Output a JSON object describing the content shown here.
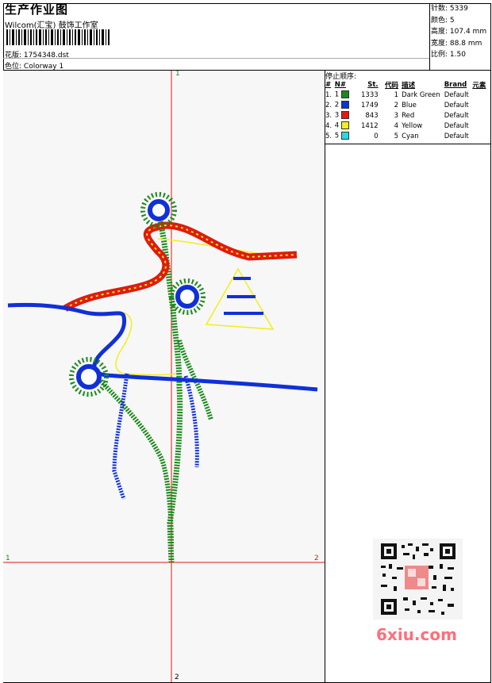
{
  "header": {
    "title": "生产作业图",
    "subtitle": "Wilcom(汇宝) 鼓饰工作室",
    "design_label": "花版:",
    "design_value": "1754348.dst",
    "colorway_label": "色位:",
    "colorway_value": "Colorway 1"
  },
  "stats": [
    {
      "label": "针数:",
      "value": "5339"
    },
    {
      "label": "颜色:",
      "value": "5"
    },
    {
      "label": "高度:",
      "value": "107.4 mm"
    },
    {
      "label": "宽度:",
      "value": "88.8 mm"
    },
    {
      "label": "比例:",
      "value": "1.50"
    }
  ],
  "stop_sequence": {
    "title": "停止顺序:",
    "headers": [
      "#",
      "N#",
      "St.",
      "代码",
      "描述",
      "Brand",
      "元素"
    ],
    "rows": [
      {
        "idx": "1.",
        "n": "1",
        "color": "#1a8a1a",
        "st": "1333",
        "code": "1",
        "desc": "Dark Green",
        "brand": "Default"
      },
      {
        "idx": "2.",
        "n": "2",
        "color": "#1030d8",
        "st": "1749",
        "code": "2",
        "desc": "Blue",
        "brand": "Default"
      },
      {
        "idx": "3.",
        "n": "3",
        "color": "#e01a10",
        "st": "843",
        "code": "3",
        "desc": "Red",
        "brand": "Default"
      },
      {
        "idx": "4.",
        "n": "4",
        "color": "#f2ee1a",
        "st": "1412",
        "code": "4",
        "desc": "Yellow",
        "brand": "Default"
      },
      {
        "idx": "5.",
        "n": "5",
        "color": "#2ad8e0",
        "st": "0",
        "code": "5",
        "desc": "Cyan",
        "brand": "Default"
      }
    ]
  },
  "axes": {
    "top": "1",
    "bottom": "2",
    "left": "1",
    "right": "2"
  },
  "watermark": {
    "site": "6xiu.com"
  }
}
